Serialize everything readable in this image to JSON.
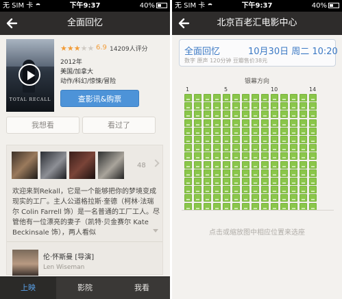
{
  "left": {
    "status": {
      "carrier": "无 SIM 卡",
      "time": "下午9:37",
      "battery": "40%"
    },
    "nav": {
      "title": "全面回忆"
    },
    "poster": {
      "title": "TOTAL RECALL",
      "subtitle": ""
    },
    "movie": {
      "rating_stars": "★★★",
      "rating_stars_dim": "★★",
      "score": "6.9",
      "votes": "14209人评分",
      "year": "2012年",
      "region": "美国/加拿大",
      "genres": "动作/科幻/惊悚/冒险",
      "buy_label": "查影讯&购票"
    },
    "actions": {
      "want": "我想看",
      "seen": "看过了"
    },
    "stills": {
      "count": "48"
    },
    "synopsis": "欢迎来到Rekall，它是一个能够把你的梦境变成现实的工厂。主人公道格拉斯·奎德（柯林·法瑞尔 Colin Farrell 饰）是一名普通的工厂工人。尽管他有一位漂亮的妻子（凯特·贝金赛尔 Kate Beckinsale 饰），两人看似",
    "director": {
      "name_cn": "伦·怀斯曼 [导演]",
      "name_en": "Len Wiseman"
    },
    "tabs": [
      "上映",
      "影院",
      "我看"
    ]
  },
  "right": {
    "status": {
      "carrier": "无 SIM 卡",
      "time": "下午9:37",
      "battery": "40%"
    },
    "nav": {
      "title": "北京百老汇电影中心"
    },
    "show": {
      "title": "全面回忆",
      "date": "10月30日 周二 10:20",
      "sub": "数字 原声 120分钟 豆瓣售价38元"
    },
    "screen_label": "银幕方向",
    "columns": [
      "1",
      "5",
      "10",
      "14"
    ],
    "seatmap": {
      "rows": 14,
      "cols": 14
    },
    "hint": "点击或缩放图中相应位置来选座"
  }
}
